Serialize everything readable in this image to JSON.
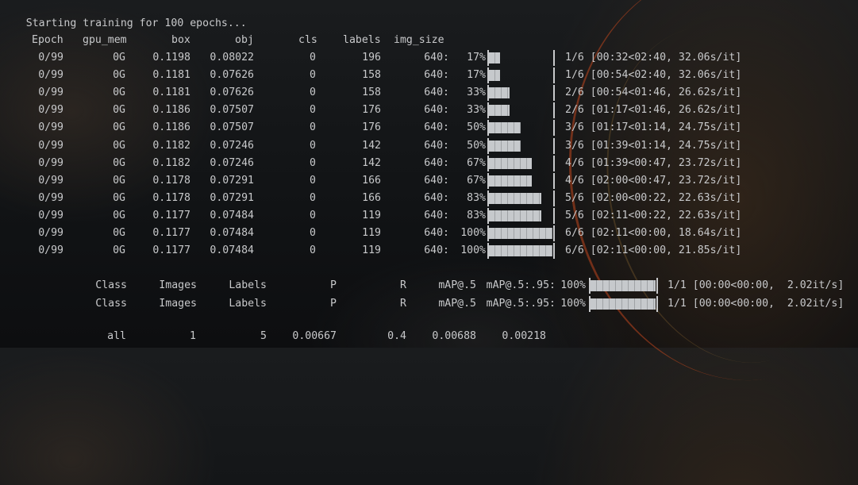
{
  "header": "Starting training for 100 epochs...",
  "columns": [
    "Epoch",
    "gpu_mem",
    "box",
    "obj",
    "cls",
    "labels",
    "img_size"
  ],
  "rows": [
    {
      "epoch": "0/99",
      "mem": "0G",
      "box": "0.1198",
      "obj": "0.08022",
      "cls": "0",
      "labels": "196",
      "size": "640:",
      "pct": "17%",
      "frac": 0.17,
      "status": "1/6 [00:32<02:40, 32.06s/it]"
    },
    {
      "epoch": "0/99",
      "mem": "0G",
      "box": "0.1181",
      "obj": "0.07626",
      "cls": "0",
      "labels": "158",
      "size": "640:",
      "pct": "17%",
      "frac": 0.17,
      "status": "1/6 [00:54<02:40, 32.06s/it]"
    },
    {
      "epoch": "0/99",
      "mem": "0G",
      "box": "0.1181",
      "obj": "0.07626",
      "cls": "0",
      "labels": "158",
      "size": "640:",
      "pct": "33%",
      "frac": 0.33,
      "status": "2/6 [00:54<01:46, 26.62s/it]"
    },
    {
      "epoch": "0/99",
      "mem": "0G",
      "box": "0.1186",
      "obj": "0.07507",
      "cls": "0",
      "labels": "176",
      "size": "640:",
      "pct": "33%",
      "frac": 0.33,
      "status": "2/6 [01:17<01:46, 26.62s/it]"
    },
    {
      "epoch": "0/99",
      "mem": "0G",
      "box": "0.1186",
      "obj": "0.07507",
      "cls": "0",
      "labels": "176",
      "size": "640:",
      "pct": "50%",
      "frac": 0.5,
      "status": "3/6 [01:17<01:14, 24.75s/it]"
    },
    {
      "epoch": "0/99",
      "mem": "0G",
      "box": "0.1182",
      "obj": "0.07246",
      "cls": "0",
      "labels": "142",
      "size": "640:",
      "pct": "50%",
      "frac": 0.5,
      "status": "3/6 [01:39<01:14, 24.75s/it]"
    },
    {
      "epoch": "0/99",
      "mem": "0G",
      "box": "0.1182",
      "obj": "0.07246",
      "cls": "0",
      "labels": "142",
      "size": "640:",
      "pct": "67%",
      "frac": 0.67,
      "status": "4/6 [01:39<00:47, 23.72s/it]"
    },
    {
      "epoch": "0/99",
      "mem": "0G",
      "box": "0.1178",
      "obj": "0.07291",
      "cls": "0",
      "labels": "166",
      "size": "640:",
      "pct": "67%",
      "frac": 0.67,
      "status": "4/6 [02:00<00:47, 23.72s/it]"
    },
    {
      "epoch": "0/99",
      "mem": "0G",
      "box": "0.1178",
      "obj": "0.07291",
      "cls": "0",
      "labels": "166",
      "size": "640:",
      "pct": "83%",
      "frac": 0.83,
      "status": "5/6 [02:00<00:22, 22.63s/it]"
    },
    {
      "epoch": "0/99",
      "mem": "0G",
      "box": "0.1177",
      "obj": "0.07484",
      "cls": "0",
      "labels": "119",
      "size": "640:",
      "pct": "83%",
      "frac": 0.83,
      "status": "5/6 [02:11<00:22, 22.63s/it]"
    },
    {
      "epoch": "0/99",
      "mem": "0G",
      "box": "0.1177",
      "obj": "0.07484",
      "cls": "0",
      "labels": "119",
      "size": "640:",
      "pct": "100%",
      "frac": 1.0,
      "status": "6/6 [02:11<00:00, 18.64s/it]"
    },
    {
      "epoch": "0/99",
      "mem": "0G",
      "box": "0.1177",
      "obj": "0.07484",
      "cls": "0",
      "labels": "119",
      "size": "640:",
      "pct": "100%",
      "frac": 1.0,
      "status": "6/6 [02:11<00:00, 21.85s/it]"
    }
  ],
  "val_header": [
    "Class",
    "Images",
    "Labels",
    "P",
    "R",
    "mAP@.5",
    "mAP@.5:.95:"
  ],
  "val_rows": [
    {
      "pct": "100%",
      "frac": 1.0,
      "status": "1/1 [00:00<00:00,  2.02it/s]"
    },
    {
      "pct": "100%",
      "frac": 1.0,
      "status": "1/1 [00:00<00:00,  2.02it/s]"
    }
  ],
  "summary": {
    "class": "all",
    "images": "1",
    "labels": "5",
    "p": "0.00667",
    "r": "0.4",
    "map50": "0.00688",
    "map": "0.00218"
  }
}
